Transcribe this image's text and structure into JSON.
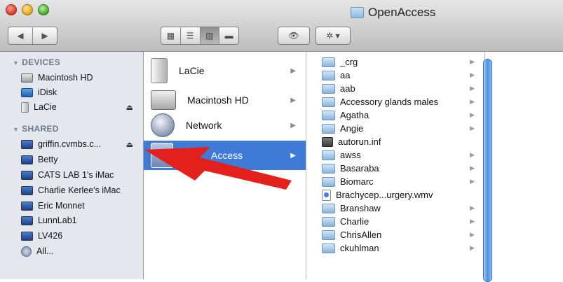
{
  "window": {
    "title": "OpenAccess"
  },
  "toolbar": {
    "nav": [
      "◀",
      "▶"
    ],
    "views": [
      "▦",
      "☰",
      "▥",
      "▬"
    ],
    "quicklook": "👁",
    "action": "✲ ▾"
  },
  "sidebar": {
    "devices_header": "DEVICES",
    "devices": [
      {
        "label": "Macintosh HD",
        "icon": "hard-drive-icon",
        "eject": ""
      },
      {
        "label": "iDisk",
        "icon": "idisk-icon",
        "eject": ""
      },
      {
        "label": "LaCie",
        "icon": "external-drive-icon",
        "eject": "⏏"
      }
    ],
    "shared_header": "SHARED",
    "shared": [
      {
        "label": "griffin.cvmbs.c...",
        "icon": "server-icon",
        "eject": "⏏"
      },
      {
        "label": "Betty",
        "icon": "computer-icon"
      },
      {
        "label": "CATS LAB 1's iMac",
        "icon": "computer-icon"
      },
      {
        "label": "Charlie Kerlee's iMac",
        "icon": "computer-icon"
      },
      {
        "label": "Eric Monnet",
        "icon": "computer-icon"
      },
      {
        "label": "LunnLab1",
        "icon": "computer-icon"
      },
      {
        "label": "LV426",
        "icon": "computer-icon"
      },
      {
        "label": "All...",
        "icon": "network-icon"
      }
    ]
  },
  "column1": [
    {
      "label": "LaCie",
      "icon": "external-drive-icon"
    },
    {
      "label": "Macintosh HD",
      "icon": "hard-drive-icon"
    },
    {
      "label": "Network",
      "icon": "network-globe-icon"
    },
    {
      "label": "Access",
      "icon": "server-icon",
      "selected": true
    }
  ],
  "column2": [
    {
      "label": "_crg",
      "type": "folder"
    },
    {
      "label": "aa",
      "type": "folder"
    },
    {
      "label": "aab",
      "type": "folder"
    },
    {
      "label": "Accessory glands males",
      "type": "folder"
    },
    {
      "label": "Agatha",
      "type": "folder"
    },
    {
      "label": "Angie",
      "type": "folder"
    },
    {
      "label": "autorun.inf",
      "type": "file-inf"
    },
    {
      "label": "awss",
      "type": "folder"
    },
    {
      "label": "Basaraba",
      "type": "folder"
    },
    {
      "label": "Biomarc",
      "type": "folder"
    },
    {
      "label": "Brachycep...urgery.wmv",
      "type": "file-wmv"
    },
    {
      "label": "Branshaw",
      "type": "folder"
    },
    {
      "label": "Charlie",
      "type": "folder"
    },
    {
      "label": "ChrisAllen",
      "type": "folder"
    },
    {
      "label": "ckuhlman",
      "type": "folder"
    }
  ],
  "colors": {
    "selection": "#3e7ad6",
    "annotation_arrow": "#e3201b"
  }
}
